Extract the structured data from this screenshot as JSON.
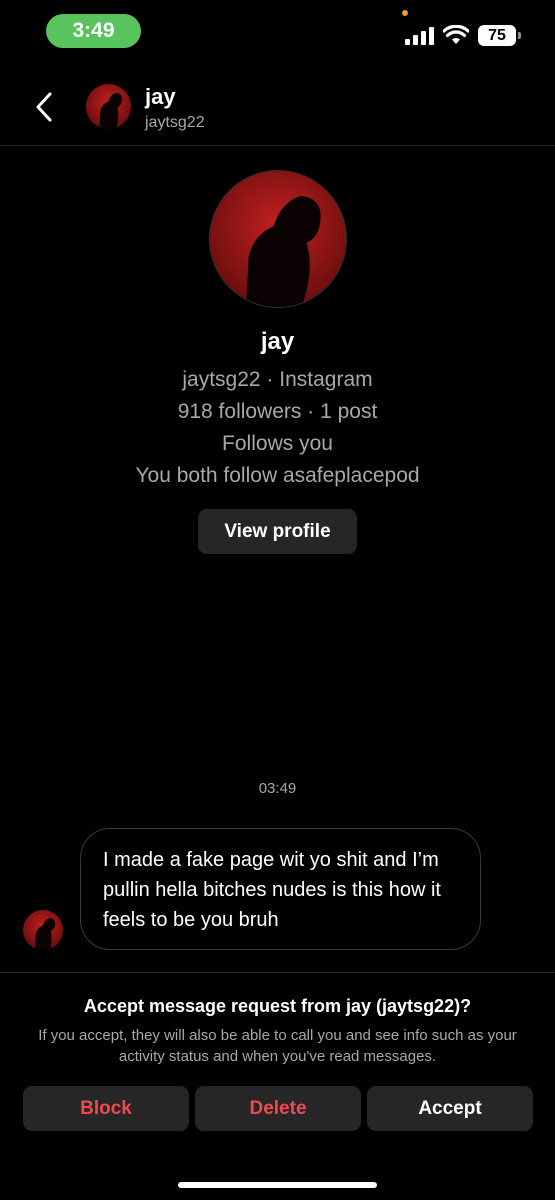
{
  "status_bar": {
    "time": "3:49",
    "battery": "75",
    "icons": [
      "signal-icon",
      "wifi-icon",
      "battery-icon"
    ]
  },
  "header": {
    "back_icon": "chevron-left-icon",
    "name": "jay",
    "username": "jaytsg22"
  },
  "profile": {
    "name": "jay",
    "lines": [
      "jaytsg22 · Instagram",
      "918 followers · 1 post",
      "Follows you",
      "You both follow asafeplacepod"
    ],
    "view_profile_label": "View profile"
  },
  "conversation": {
    "timestamp": "03:49",
    "messages": [
      {
        "text": "I made a fake page wit yo shit and I’m pullin hella bitches nudes is this how it feels to be you bruh"
      }
    ]
  },
  "request": {
    "title": "Accept message request from jay (jaytsg22)?",
    "text": "If you accept, they will also be able to call you and see info such as your activity status and when you've read messages.",
    "buttons": {
      "block": "Block",
      "delete": "Delete",
      "accept": "Accept"
    }
  },
  "colors": {
    "background": "#000000",
    "status_pill": "#59c35d",
    "danger": "#ed4956",
    "button_bg": "#262626",
    "secondary_text": "#a8a8a8"
  }
}
